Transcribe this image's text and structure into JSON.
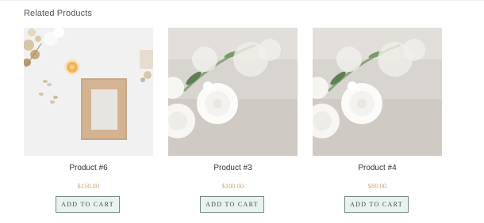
{
  "section": {
    "title": "Related Products"
  },
  "products": [
    {
      "image_icon": "frame-photo-icon",
      "name": "Product #6",
      "price": "$150.00",
      "button_label": "ADD TO CART"
    },
    {
      "image_icon": "white-flowers-photo-icon",
      "name": "Product #3",
      "price": "$100.00",
      "button_label": "ADD TO CART"
    },
    {
      "image_icon": "white-flowers-photo-icon",
      "name": "Product #4",
      "price": "$80.00",
      "button_label": "ADD TO CART"
    }
  ],
  "colors": {
    "price": "#c9a06a",
    "button_bg": "#e8f3ef",
    "button_border": "#7a8a84"
  }
}
